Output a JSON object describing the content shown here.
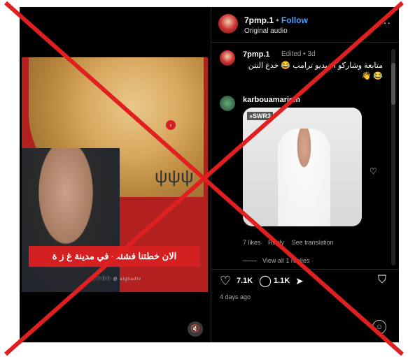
{
  "header": {
    "username": "7pmp.1",
    "separator": "•",
    "follow_label": "Follow",
    "subtitle": "Original audio",
    "more": "···"
  },
  "video": {
    "caption": "الان خطتنا فشلت في مدينة غ ز ة",
    "social_handle": "ⓕⓘⓨⓣ @ alghadtv",
    "mute_icon": "🔇",
    "menorah": "ψψψ",
    "red_dot": "‹"
  },
  "comments": [
    {
      "username": "7pmp.1",
      "meta": "Edited • 3d",
      "text": "متابعة وشاركو الفيديو ترامب 😂 خدع النتن 😂 👋"
    },
    {
      "username": "karbouamariem",
      "gif_logo": "»SWR3",
      "likes": "7 likes",
      "reply": "Reply",
      "see_translation": "See translation",
      "view_replies": "View all 1 replies"
    }
  ],
  "actions": {
    "like_icon": "♡",
    "likes": "7.1K",
    "comment_icon": "◯",
    "comments": "1.1K",
    "share_icon": "➤",
    "save_icon": "⛉",
    "heart_small": "♡",
    "date": "4 days ago",
    "emoji_icon": "☺"
  },
  "overlay_color": "#e02020"
}
